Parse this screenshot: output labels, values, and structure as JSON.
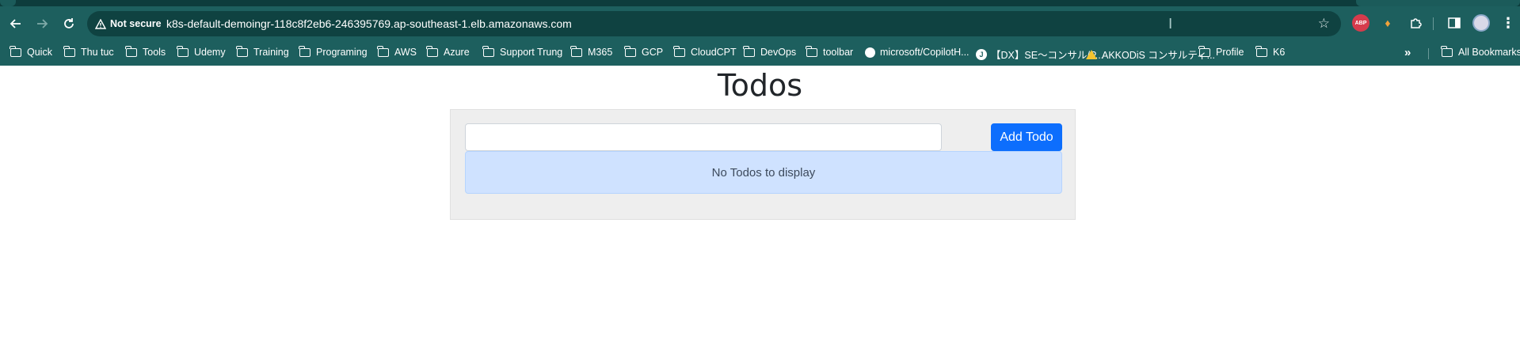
{
  "browser": {
    "security_label": "Not secure",
    "url": "k8s-default-demoingr-118c8f2eb6-246395769.ap-southeast-1.elb.amazonaws.com",
    "extensions": {
      "abp_label": "ABP"
    }
  },
  "bookmarks": {
    "items": [
      {
        "label": "Quick",
        "icon": "folder-icon"
      },
      {
        "label": "Thu tuc",
        "icon": "folder-icon"
      },
      {
        "label": "Tools",
        "icon": "folder-icon"
      },
      {
        "label": "Udemy",
        "icon": "folder-icon"
      },
      {
        "label": "Training",
        "icon": "folder-icon"
      },
      {
        "label": "Programing",
        "icon": "folder-icon"
      },
      {
        "label": "AWS",
        "icon": "folder-icon"
      },
      {
        "label": "Azure",
        "icon": "folder-icon"
      },
      {
        "label": "Support Trung",
        "icon": "folder-icon"
      },
      {
        "label": "M365",
        "icon": "folder-icon"
      },
      {
        "label": "GCP",
        "icon": "folder-icon"
      },
      {
        "label": "CloudCPT",
        "icon": "folder-icon"
      },
      {
        "label": "DevOps",
        "icon": "folder-icon"
      },
      {
        "label": "toolbar",
        "icon": "folder-icon"
      },
      {
        "label": "microsoft/CopilotH...",
        "icon": "github-icon"
      },
      {
        "label": "【DX】SE〜コンサル/P...",
        "icon": "site-icon"
      },
      {
        "label": "AKKODiS コンサルティ...",
        "icon": "drive-icon"
      },
      {
        "label": "Profile",
        "icon": "folder-icon"
      },
      {
        "label": "K6",
        "icon": "folder-icon"
      }
    ],
    "all_bookmarks_label": "All Bookmarks"
  },
  "app": {
    "title": "Todos",
    "input_value": "",
    "add_button_label": "Add Todo",
    "empty_message": "No Todos to display"
  },
  "colors": {
    "chrome_bg": "#1d5f5e",
    "omnibox_bg": "#0f4241",
    "primary_button": "#0d6efd",
    "alert_bg": "#cfe2ff",
    "card_bg": "#eeeeee"
  }
}
